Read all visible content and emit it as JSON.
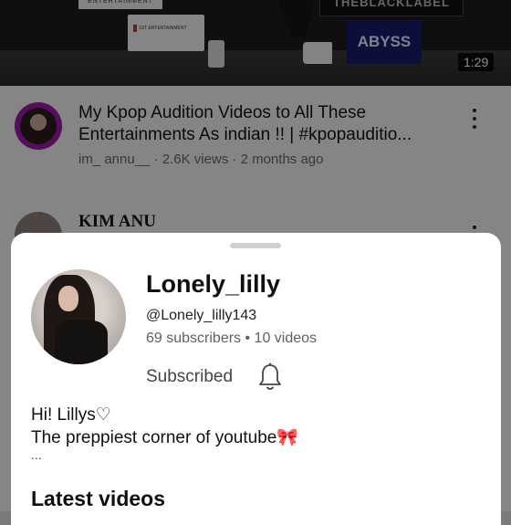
{
  "video": {
    "duration": "1:29",
    "thumbnail_signs": {
      "entertainment": "ENTERTAINMENT",
      "first_label": "1ST ENTERTAINMENT",
      "bleach": "THEBLACKLABEL",
      "abyss": "ABYSS"
    },
    "title": "My Kpop Audition Videos to All These Entertainments As indian !! | #kpopauditio...",
    "meta": "im_ annu__ · 2.6K views · 2 months ago"
  },
  "next_item": {
    "channel": "KIM ANU"
  },
  "sheet": {
    "channel_name": "Lonely_lilly",
    "handle": "@Lonely_lilly143",
    "stats": "69 subscribers • 10 videos",
    "subscribed_label": "Subscribed",
    "description_line1": "Hi! Lillys♡",
    "description_line2": "The preppiest corner of youtube🎀",
    "description_more": "...",
    "latest_heading": "Latest videos"
  },
  "icons": {
    "bell": "bell-icon",
    "kebab": "more-vert-icon"
  },
  "colors": {
    "avatar_ring": "#9a1aa8",
    "abyss_bg": "#1a1a6a"
  }
}
